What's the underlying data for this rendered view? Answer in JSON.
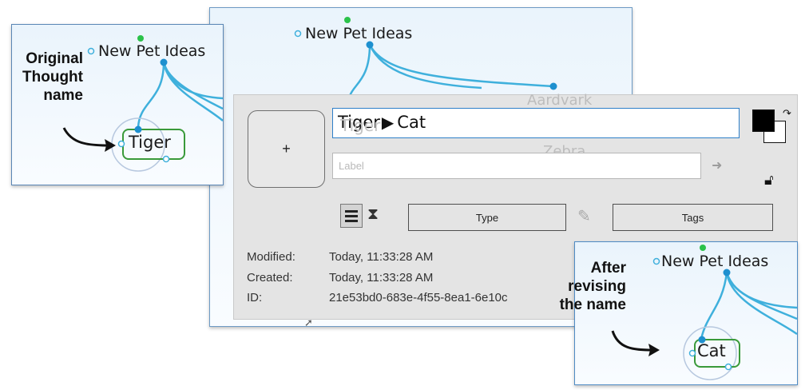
{
  "map_before": {
    "parent": "New Pet Ideas",
    "child": "Tiger"
  },
  "main_map": {
    "parent": "New Pet Ideas",
    "child_aardvark": "Aardvark",
    "child_zebra": "Zebra",
    "child_tiger_ghost": "Tiger"
  },
  "map_after": {
    "parent": "New Pet Ideas",
    "child": "Cat"
  },
  "annotations": {
    "original": [
      "Original",
      "Thought",
      "name"
    ],
    "after": [
      "After",
      "revising",
      "the name"
    ]
  },
  "properties": {
    "add_label": "+",
    "name_old": "Tiger",
    "name_new": "Cat",
    "label_placeholder": "Label",
    "type_label": "Type",
    "tags_label": "Tags",
    "modified_label": "Modified:",
    "modified_value": "Today, 11:33:28 AM",
    "created_label": "Created:",
    "created_value": "Today, 11:33:28 AM",
    "id_label": "ID:",
    "id_value": "21e53bd0-683e-4f55-8ea1-6e10c"
  },
  "colors": {
    "link": "#3fb0dc",
    "node_active": "#1e90cf",
    "node_gate": "#2bc24a",
    "thought_border": "#3a9a3a",
    "field_border": "#2e7fc8"
  }
}
